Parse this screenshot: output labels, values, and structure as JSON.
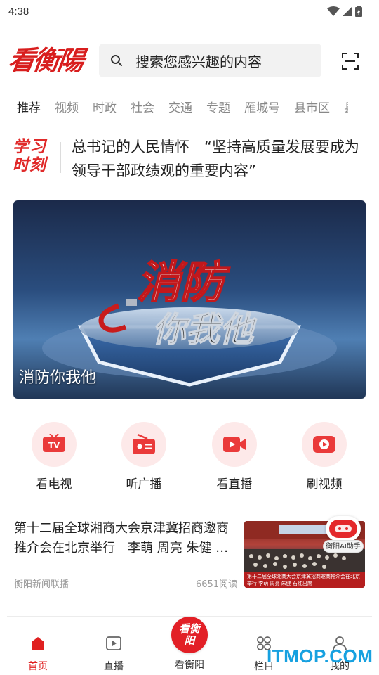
{
  "status_bar": {
    "time": "4:38"
  },
  "header": {
    "logo_text": "看衡陽",
    "search_placeholder": "搜索您感兴趣的内容"
  },
  "tabs": [
    "推荐",
    "视频",
    "时政",
    "社会",
    "交通",
    "专题",
    "雁城号",
    "县市区",
    "县"
  ],
  "headline": {
    "badge_line1": "学习",
    "badge_line2": "时刻",
    "text": "总书记的人民情怀｜“坚持高质量发展要成为领导干部政绩观的重要内容”"
  },
  "banner": {
    "art_line1": "消防",
    "art_line2": "你我他",
    "caption": "消防你我他"
  },
  "quick_entries": [
    {
      "label": "看电视",
      "icon": "tv-icon"
    },
    {
      "label": "听广播",
      "icon": "radio-icon"
    },
    {
      "label": "看直播",
      "icon": "live-camera-icon"
    },
    {
      "label": "刷视频",
      "icon": "video-play-icon"
    }
  ],
  "news": {
    "title": "第十二届全球湘商大会京津冀招商邀商推介会在北京举行　李萌 周亮 朱健 …",
    "source": "衡阳新闻联播",
    "reads": "6651阅读",
    "thumb_caption": "第十二届全球湘商大会京津冀招商邀商推介会在北京举行 李萌 周亮 朱健 石红出席"
  },
  "ai_assistant": {
    "label": "衡阳AI助手"
  },
  "bottom_nav": [
    {
      "label": "首页",
      "icon": "home-icon",
      "active": true
    },
    {
      "label": "直播",
      "icon": "live-play-icon",
      "active": false
    },
    {
      "label": "看衡阳",
      "icon": "kan-hengyang-badge",
      "active": false,
      "badge_text": "看衡阳"
    },
    {
      "label": "栏目",
      "icon": "grid-icon",
      "active": false
    },
    {
      "label": "我的",
      "icon": "user-icon",
      "active": false
    }
  ],
  "watermark": "ITMOP.COM",
  "colors": {
    "accent": "#e02020",
    "brand_red": "#d81e1e",
    "watermark": "#17a1e0"
  }
}
